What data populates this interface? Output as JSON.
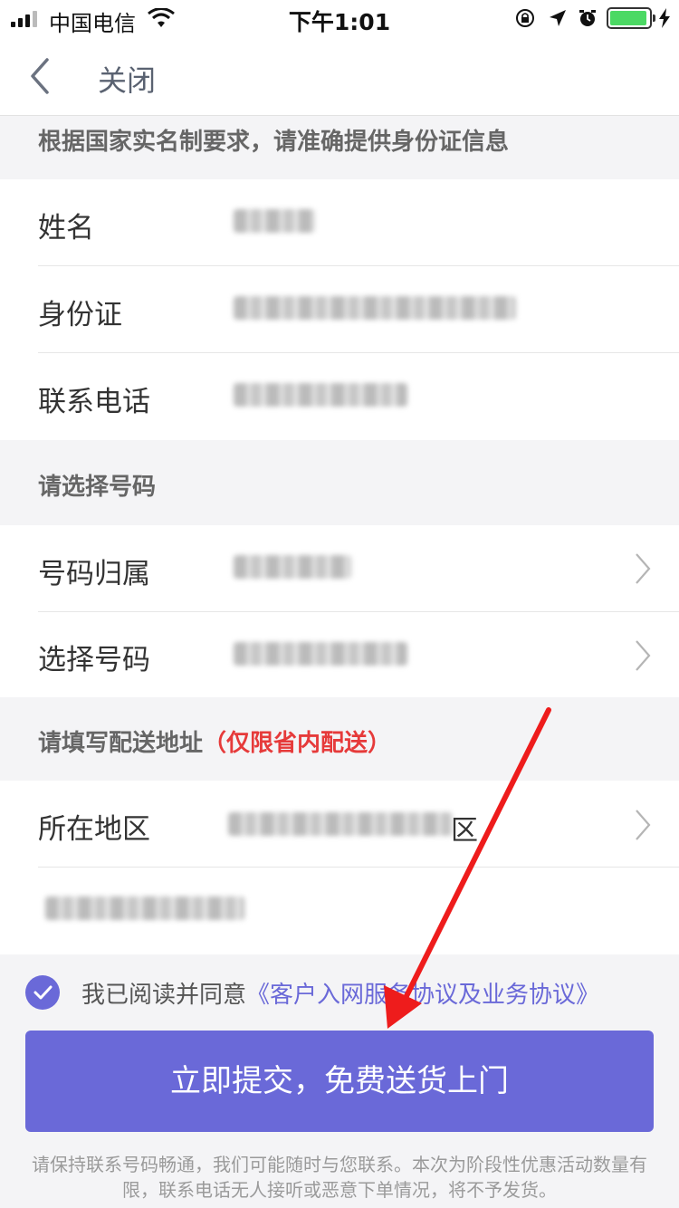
{
  "status_bar": {
    "carrier": "中国电信",
    "time": "下午1:01",
    "battery_color": "#4cd964"
  },
  "nav": {
    "back_icon": "chevron-left-icon",
    "close_label": "关闭"
  },
  "identity": {
    "header": "根据国家实名制要求，请准确提供身份证信息",
    "rows": [
      {
        "label": "姓名"
      },
      {
        "label": "身份证"
      },
      {
        "label": "联系电话"
      }
    ]
  },
  "number": {
    "header": "请选择号码",
    "rows": [
      {
        "label": "号码归属"
      },
      {
        "label": "选择号码"
      }
    ]
  },
  "delivery": {
    "header": "请填写配送地址",
    "header_note": "（仅限省内配送）",
    "region_label": "所在地区",
    "region_suffix": "区"
  },
  "agreement": {
    "prefix": "我已阅读并同意",
    "link": "《客户入网服务协议及业务协议》"
  },
  "submit_label": "立即提交，免费送货上门",
  "footer_note": "请保持联系号码畅通，我们可能随时与您联系。本次为阶段性优惠活动数量有限，联系电话无人接听或恶意下单情况，将不予发货。",
  "colors": {
    "accent": "#6a69d8",
    "warning_red": "#e63a3a",
    "annotation_arrow": "#ee1c1c"
  }
}
